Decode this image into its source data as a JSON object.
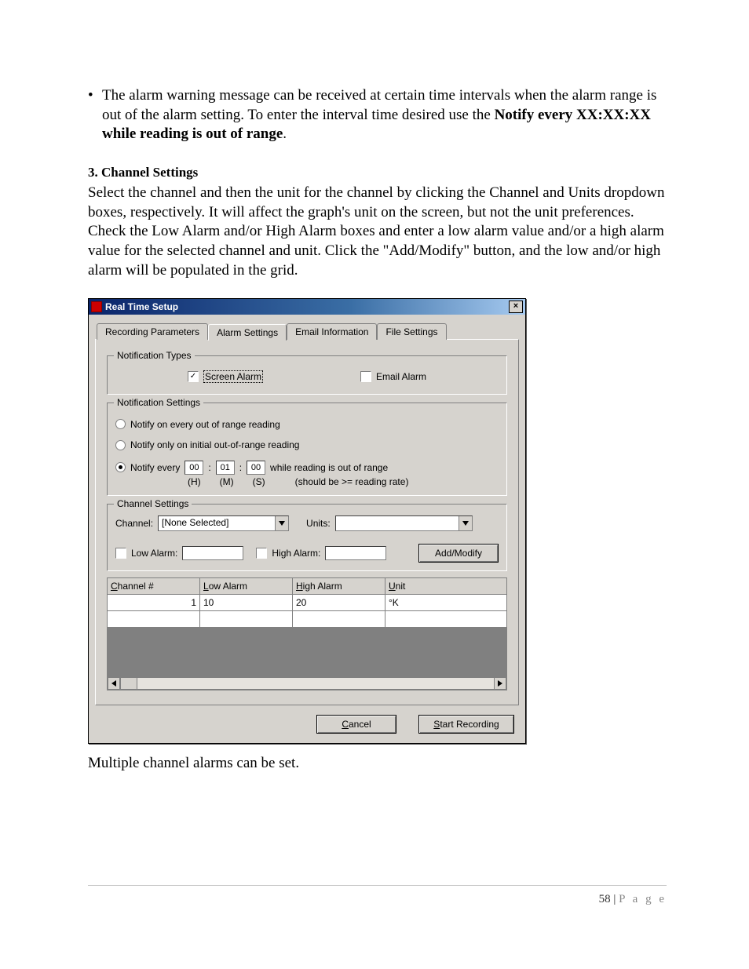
{
  "doc": {
    "bullet_text_prefix": "The alarm warning message can be received at certain time intervals when the alarm range is out of the alarm setting. To enter the interval time desired use the ",
    "bullet_bold": "Notify every XX:XX:XX while reading is out of range",
    "bullet_suffix": ".",
    "heading3": "3. Channel Settings",
    "para2": "Select the channel and then the unit for the channel by clicking the Channel and Units dropdown boxes, respectively. It will affect the graph's unit on the screen, but not the unit preferences. Check the Low Alarm and/or High Alarm boxes and enter a low alarm value and/or a high alarm value for the selected channel and unit. Click the \"Add/Modify\" button, and the low and/or high alarm will be populated in the grid.",
    "after_dialog": "Multiple channel alarms can be set.",
    "page_number": "58",
    "page_label": "P a g e"
  },
  "dialog": {
    "title": "Real Time Setup",
    "tabs": {
      "recording": "Recording Parameters",
      "alarm": "Alarm Settings",
      "email": "Email Information",
      "file": "File Settings"
    },
    "notif_types": {
      "legend": "Notification Types",
      "screen_checked": true,
      "screen_label": "Screen Alarm",
      "email_checked": false,
      "email_label": "Email Alarm"
    },
    "notif_settings": {
      "legend": "Notification Settings",
      "opt1": "Notify on every out of range reading",
      "opt2": "Notify only on initial out-of-range reading",
      "opt3_prefix": "Notify every",
      "h": "00",
      "m": "01",
      "s": "00",
      "opt3_suffix": "while reading is out of range",
      "hlbl": "(H)",
      "mlbl": "(M)",
      "slbl": "(S)",
      "rate_note": "(should be >= reading rate)",
      "selected": "opt3"
    },
    "channel_settings": {
      "legend": "Channel Settings",
      "channel_label": "Channel:",
      "channel_value": "[None Selected]",
      "units_label": "Units:",
      "units_value": "",
      "low_alarm_label": "Low Alarm:",
      "low_alarm_checked": false,
      "low_alarm_value": "",
      "high_alarm_label": "High Alarm:",
      "high_alarm_checked": false,
      "high_alarm_value": "",
      "addmodify": "Add/Modify"
    },
    "grid": {
      "headers": {
        "channel": "Channel #",
        "low": "Low Alarm",
        "high": "High Alarm",
        "unit": "Unit"
      },
      "rows": [
        {
          "channel": "1",
          "low": "10",
          "high": "20",
          "unit": "°K"
        }
      ]
    },
    "buttons": {
      "cancel_mn": "C",
      "cancel_rest": "ancel",
      "start_mn": "S",
      "start_rest": "tart Recording"
    }
  }
}
